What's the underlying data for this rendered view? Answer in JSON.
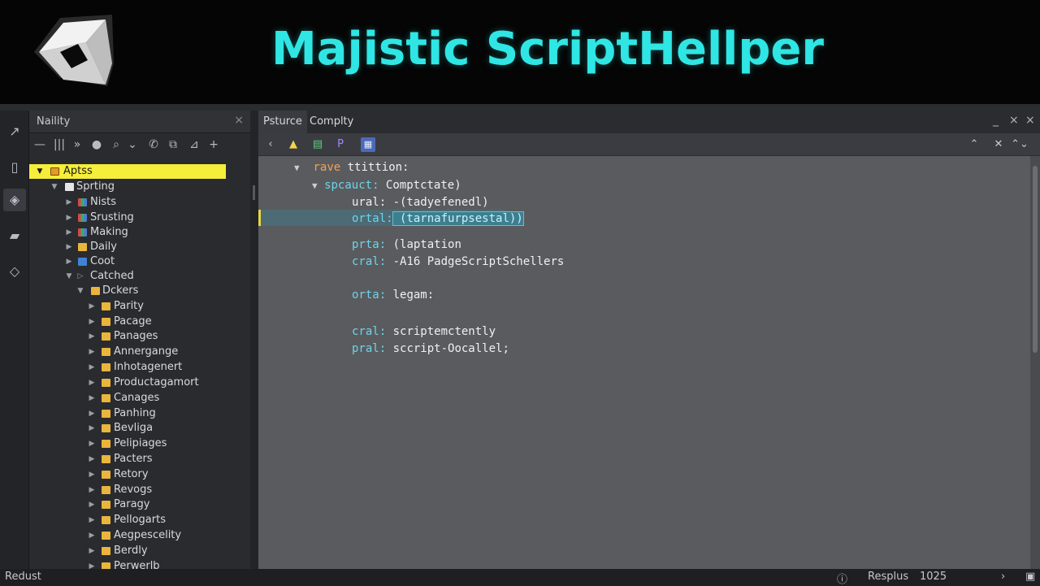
{
  "app": {
    "title": "Majistic ScriptHellper",
    "brand_color": "#2fe6e4"
  },
  "toolstrip": {
    "icons": [
      "wand-icon",
      "panel-icon",
      "unity-icon",
      "gamepad-icon",
      "unity-outline-icon"
    ]
  },
  "hierarchy": {
    "title": "Naility",
    "close_glyph": "×",
    "toolbar": [
      "—",
      "|||",
      "»",
      "●",
      "⌕",
      "⌄",
      "✆",
      "⧉",
      "⊿",
      "+"
    ],
    "rows": [
      {
        "label": "Aptss",
        "selected": true
      },
      {
        "label": "Sprting"
      },
      {
        "label": "Nists"
      },
      {
        "label": "Srusting"
      },
      {
        "label": "Making"
      },
      {
        "label": "Daily"
      },
      {
        "label": "Coot"
      },
      {
        "label": "Catched"
      },
      {
        "label": "Dckers"
      },
      {
        "label": "Parity"
      },
      {
        "label": "Pacage"
      },
      {
        "label": "Panages"
      },
      {
        "label": "Annergange"
      },
      {
        "label": "Inhotagenert"
      },
      {
        "label": "Productagamort"
      },
      {
        "label": "Canages"
      },
      {
        "label": "Panhing"
      },
      {
        "label": "Bevliga"
      },
      {
        "label": "Pelipiages"
      },
      {
        "label": "Pacters"
      },
      {
        "label": "Retory"
      },
      {
        "label": "Revogs"
      },
      {
        "label": "Paragy"
      },
      {
        "label": "Pellogarts"
      },
      {
        "label": "Aegpescelity"
      },
      {
        "label": "Berdly"
      },
      {
        "label": "Perwerlb"
      }
    ]
  },
  "editor": {
    "tabs": [
      "Psturce",
      "Complty"
    ],
    "window_controls": [
      "_",
      "×",
      "×"
    ],
    "toolbar_right": [
      "⌃",
      "✕",
      "⌃⌄"
    ],
    "code": [
      {
        "key": "rave",
        "rest": " ttittion:"
      },
      {
        "key": "spcauct:",
        "rest": " Comptctate)"
      },
      {
        "key": "ural",
        "rest": ": -(tadyefenedl)"
      },
      {
        "key": "ortal:",
        "rest": " (tarnafurpsestal))"
      },
      {
        "key": "prta:",
        "rest": " (laptation"
      },
      {
        "key": "cral:",
        "rest": " -A16 PadgeScriptSchellers"
      },
      {
        "key": "orta:",
        "rest": " legam:"
      },
      {
        "key": "cral:",
        "rest": " scriptemctently"
      },
      {
        "key": "pral:",
        "rest": " sccript-Oocallel;"
      }
    ]
  },
  "status": {
    "left": "Redust",
    "item1": "Resplus",
    "item2": "1025",
    "arrow": "›"
  }
}
